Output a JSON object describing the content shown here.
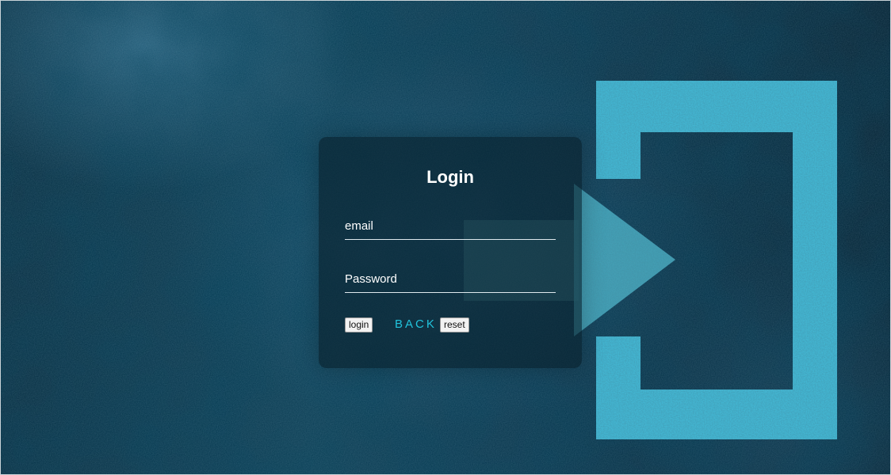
{
  "login": {
    "title": "Login",
    "email_placeholder": "email",
    "password_placeholder": "Password",
    "login_button": "login",
    "back_link": "BACK",
    "reset_button": "reset"
  },
  "artwork": {
    "icon": "exit-door-arrow-icon",
    "accent_color": "#3fb3cf",
    "background_color": "#0d3a51"
  }
}
